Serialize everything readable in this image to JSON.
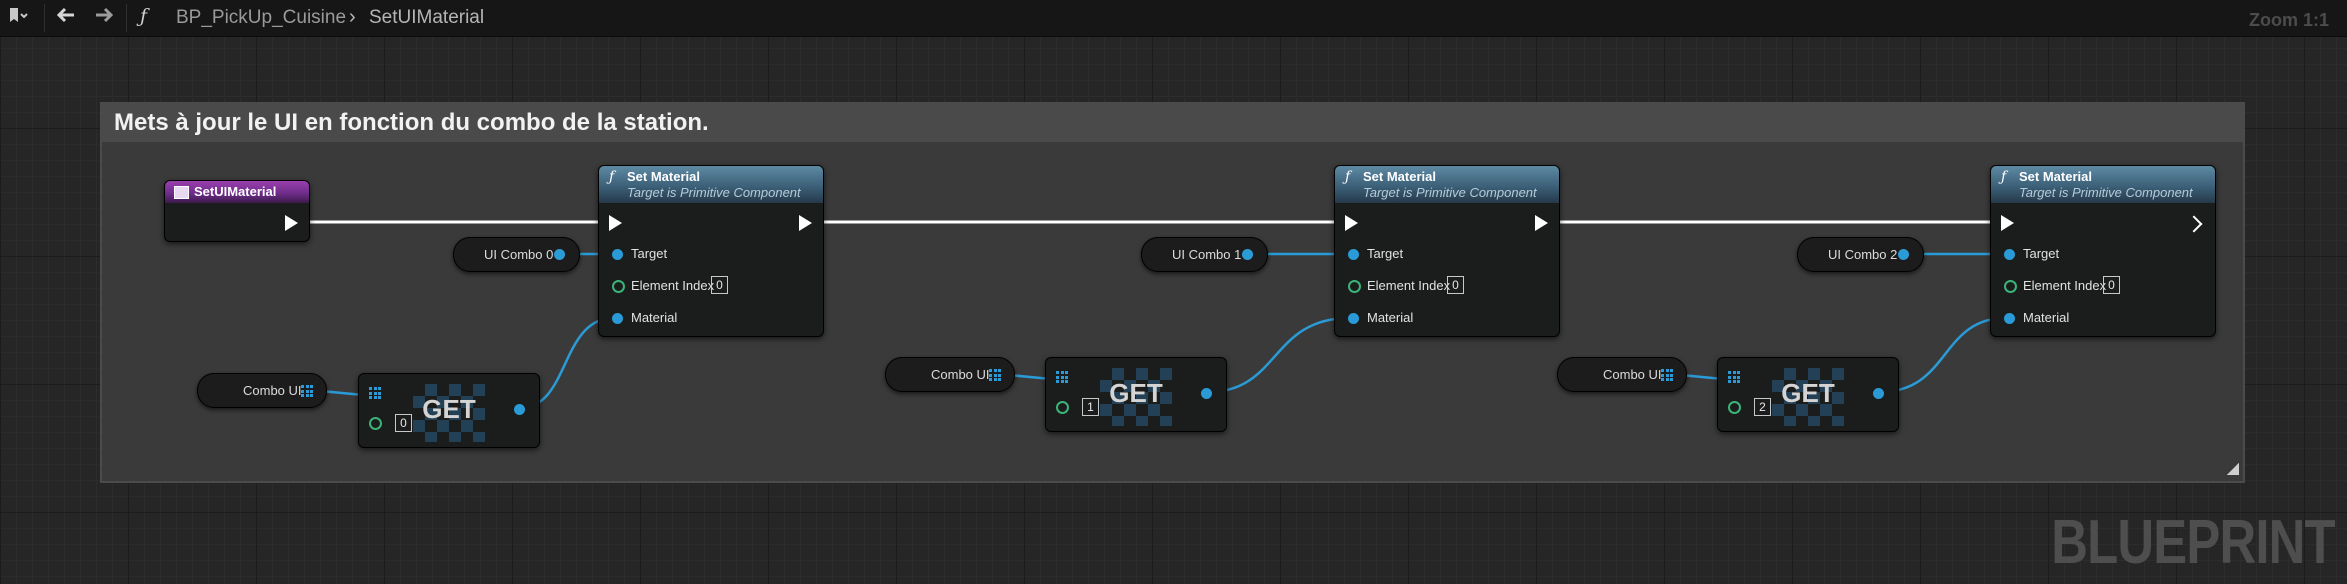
{
  "toolbar": {
    "function_symbol": "ƒ",
    "blueprint_name": "BP_PickUp_Cuisine",
    "breadcrumb_separator": "›",
    "function_name": "SetUIMaterial",
    "zoom_label": "Zoom 1:1",
    "icons": [
      "bookmark-icon",
      "back-arrow-icon",
      "forward-arrow-icon"
    ]
  },
  "graph": {
    "watermark": "BLUEPRINT",
    "comment_text": "Mets à jour le UI en fonction du combo de la station.",
    "entry_node": {
      "title": "SetUIMaterial",
      "color": "#8a3aa2"
    },
    "set_material_nodes": [
      {
        "title": "Set Material",
        "subtitle": "Target is Primitive Component",
        "pin_target": "Target",
        "pin_element_index": "Element Index",
        "element_index_value": "0",
        "pin_material": "Material"
      },
      {
        "title": "Set Material",
        "subtitle": "Target is Primitive Component",
        "pin_target": "Target",
        "pin_element_index": "Element Index",
        "element_index_value": "0",
        "pin_material": "Material"
      },
      {
        "title": "Set Material",
        "subtitle": "Target is Primitive Component",
        "pin_target": "Target",
        "pin_element_index": "Element Index",
        "element_index_value": "0",
        "pin_material": "Material"
      }
    ],
    "target_vars": [
      "UI Combo 0",
      "UI Combo 1",
      "UI Combo 2"
    ],
    "array_vars": [
      "Combo UI",
      "Combo UI",
      "Combo UI"
    ],
    "get_nodes": [
      {
        "label": "GET",
        "index": "0"
      },
      {
        "label": "GET",
        "index": "1"
      },
      {
        "label": "GET",
        "index": "2"
      }
    ],
    "colors": {
      "object_pin": "#2a9bd6",
      "int_pin": "#3bb478",
      "exec": "#ffffff",
      "function_header": "#4b7592"
    }
  }
}
